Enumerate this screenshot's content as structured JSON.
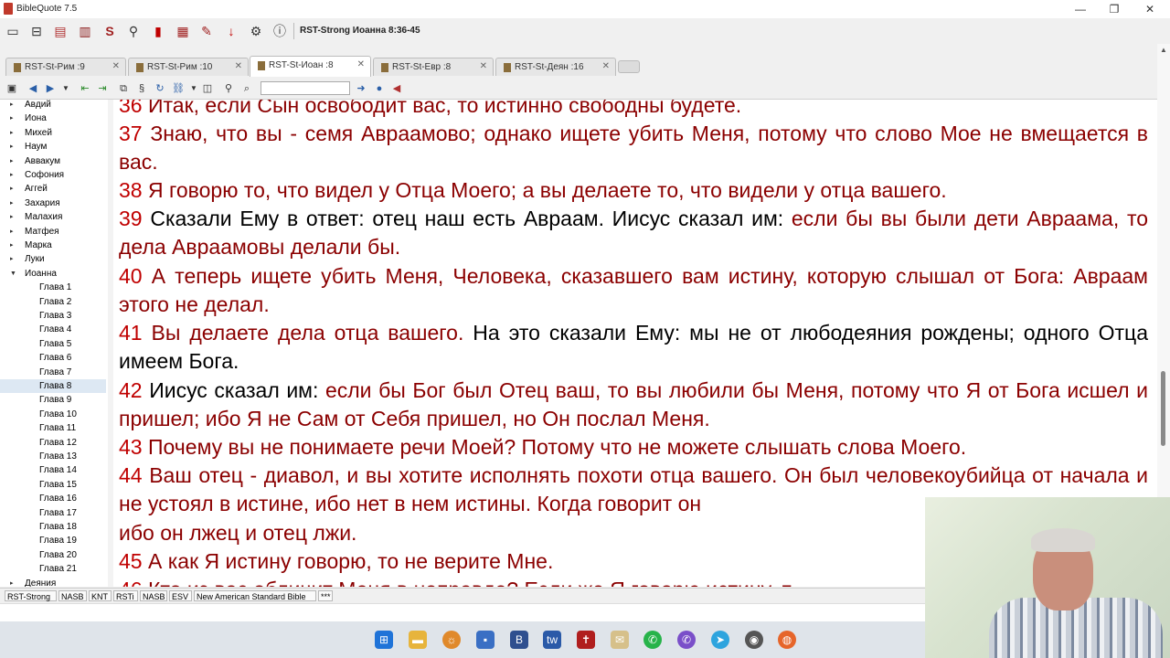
{
  "window": {
    "title": "BibleQuote 7.5",
    "controls": {
      "minimize": "—",
      "restore": "❐",
      "close": "✕"
    }
  },
  "toolbar": {
    "reference": "RST-Strong Иоанна 8:36-45",
    "icons": [
      "layout-icon",
      "new-tab-icon",
      "history-icon",
      "library-icon",
      "strong-s-icon",
      "search-icon",
      "bookmark-icon",
      "bookmarks-list-icon",
      "notes-icon",
      "download-icon",
      "settings-icon",
      "info-icon"
    ]
  },
  "tabs": [
    {
      "label": "RST-St-Рим :9",
      "close": "✕"
    },
    {
      "label": "RST-St-Рим :10",
      "close": "✕"
    },
    {
      "label": "RST-St-Иоан :8",
      "close": "✕",
      "active": true
    },
    {
      "label": "RST-St-Евр :8",
      "close": "✕"
    },
    {
      "label": "RST-St-Деян :16",
      "close": "✕"
    }
  ],
  "sidebar": {
    "books_before": [
      "Авдий",
      "Иона",
      "Михей",
      "Наум",
      "Аввакум",
      "Софония",
      "Аггей",
      "Захария",
      "Малахия",
      "Матфея",
      "Марка",
      "Луки"
    ],
    "open_book": "Иоанна",
    "chapters": [
      "Глава 1",
      "Глава 2",
      "Глава 3",
      "Глава 4",
      "Глава 5",
      "Глава 6",
      "Глава 7",
      "Глава 8",
      "Глава 9",
      "Глава 10",
      "Глава 11",
      "Глава 12",
      "Глава 13",
      "Глава 14",
      "Глава 15",
      "Глава 16",
      "Глава 17",
      "Глава 18",
      "Глава 19",
      "Глава 20",
      "Глава 21"
    ],
    "selected_chapter": "Глава 8",
    "books_after": [
      "Деяния"
    ]
  },
  "verses": [
    {
      "num": "36",
      "parts": [
        {
          "t": "Итак, если Сын освободит вас, то истинно свободны будете.",
          "c": "r"
        }
      ]
    },
    {
      "num": "37",
      "parts": [
        {
          "t": "Знаю, что вы - семя Авраамово; однако ищете убить Меня, потому что слово Мое не вмещается в вас.",
          "c": "r"
        }
      ]
    },
    {
      "num": "38",
      "parts": [
        {
          "t": "Я говорю то, что видел у Отца Моего; а вы делаете то, что видели у отца вашего.",
          "c": "r"
        }
      ]
    },
    {
      "num": "39",
      "parts": [
        {
          "t": "Сказали Ему в ответ: отец наш есть Авраам. Иисус сказал им: ",
          "c": "k"
        },
        {
          "t": "если бы вы были дети Авраама, то дела Авраамовы делали бы.",
          "c": "r"
        }
      ]
    },
    {
      "num": "40",
      "parts": [
        {
          "t": "А теперь ищете убить Меня, Человека, сказавшего вам истину, которую слышал от Бога: Авраам этого не делал.",
          "c": "r"
        }
      ]
    },
    {
      "num": "41",
      "parts": [
        {
          "t": "Вы делаете дела отца вашего. ",
          "c": "r"
        },
        {
          "t": "На это сказали Ему: мы не от любодеяния рождены; одного Отца имеем Бога.",
          "c": "k"
        }
      ]
    },
    {
      "num": "42",
      "parts": [
        {
          "t": "Иисус сказал им: ",
          "c": "k"
        },
        {
          "t": "если бы Бог был Отец ваш, то вы любили бы Меня, потому что Я от Бога исшел и пришел; ибо Я не Сам от Себя пришел, но Он послал Меня.",
          "c": "r"
        }
      ]
    },
    {
      "num": "43",
      "parts": [
        {
          "t": "Почему вы не понимаете речи Моей? Потому что не можете слышать слова Моего.",
          "c": "r"
        }
      ]
    },
    {
      "num": "44",
      "parts": [
        {
          "t": "Ваш отец - диавол, и вы хотите исполнять похоти отца вашего. Он был человекоубийца от начала и не устоял в истине, ибо нет в нем истины. Когда говорит он",
          "c": "r"
        }
      ]
    },
    {
      "num": "",
      "parts": [
        {
          "t": "ибо он лжец и отец лжи.",
          "c": "r"
        }
      ]
    },
    {
      "num": "45",
      "parts": [
        {
          "t": "А как Я истину говорю, то не верите Мне.",
          "c": "r"
        }
      ]
    },
    {
      "num": "46",
      "parts": [
        {
          "t": "Кто из вас обличит Меня в неправде? Если же Я говорю истину, п",
          "c": "r"
        }
      ]
    }
  ],
  "modules": [
    "RST-Strong",
    "NASB",
    "KNT",
    "RSTi",
    "NASB",
    "ESV",
    "New American Standard Bible",
    "***"
  ],
  "colors": {
    "verse_number": "#c00000",
    "words_of_jesus": "#8b0000",
    "narrative": "#000000"
  }
}
